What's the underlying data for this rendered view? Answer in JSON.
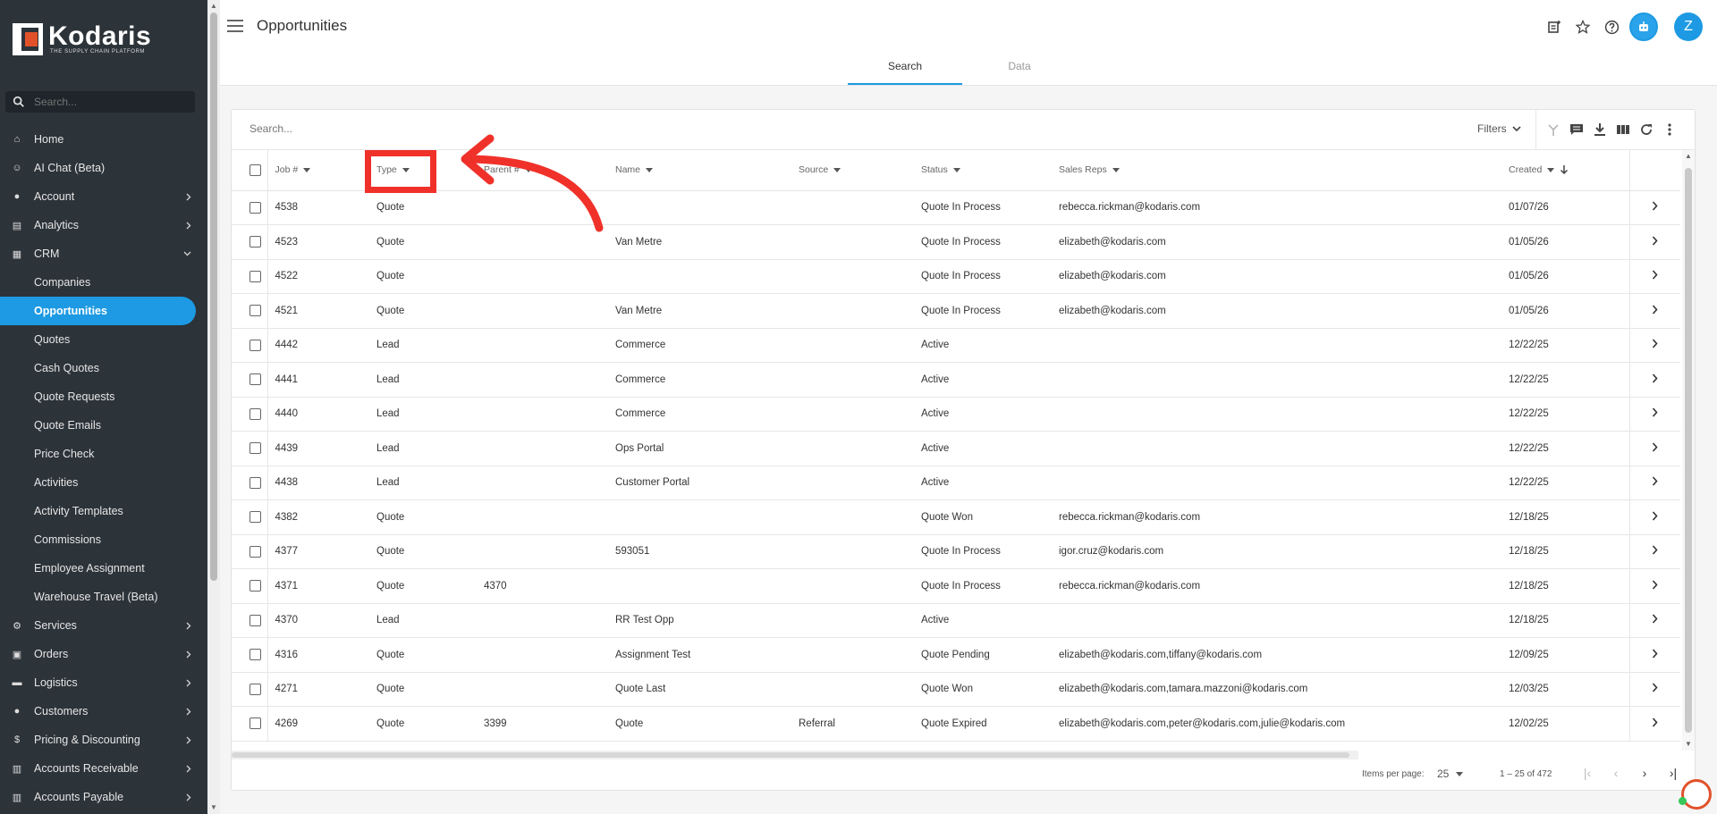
{
  "brand": {
    "name": "Kodaris",
    "tagline": "THE SUPPLY CHAIN PLATFORM",
    "accent": "#1d9ae3",
    "logo_orange": "#e1522b"
  },
  "sidebar": {
    "search_placeholder": "Search...",
    "items": [
      {
        "label": "Home",
        "icon": "home-icon"
      },
      {
        "label": "AI Chat (Beta)",
        "icon": "robot-icon"
      },
      {
        "label": "Account",
        "icon": "person-icon",
        "expandable": true
      },
      {
        "label": "Analytics",
        "icon": "chart-icon",
        "expandable": true
      },
      {
        "label": "CRM",
        "icon": "crm-icon",
        "expanded": true
      }
    ],
    "crm_sub": [
      "Companies",
      "Opportunities",
      "Quotes",
      "Cash Quotes",
      "Quote Requests",
      "Quote Emails",
      "Price Check",
      "Activities",
      "Activity Templates",
      "Commissions",
      "Employee Assignment",
      "Warehouse Travel (Beta)"
    ],
    "active_sub": "Opportunities",
    "items_after": [
      {
        "label": "Services",
        "icon": "services-icon"
      },
      {
        "label": "Orders",
        "icon": "orders-icon"
      },
      {
        "label": "Logistics",
        "icon": "truck-icon"
      },
      {
        "label": "Customers",
        "icon": "people-icon"
      },
      {
        "label": "Pricing & Discounting",
        "icon": "dollar-icon"
      },
      {
        "label": "Accounts Receivable",
        "icon": "bank-icon"
      },
      {
        "label": "Accounts Payable",
        "icon": "bank-icon"
      }
    ]
  },
  "header": {
    "title": "Opportunities",
    "avatar_initial": "Z"
  },
  "tabs": [
    {
      "label": "Search",
      "active": true
    },
    {
      "label": "Data",
      "active": false
    }
  ],
  "toolbar": {
    "search_placeholder": "Search...",
    "filters_label": "Filters"
  },
  "table": {
    "columns": [
      "Job #",
      "Type",
      "Parent #",
      "Name",
      "Source",
      "Status",
      "Sales Reps",
      "Created"
    ],
    "rows": [
      [
        "4538",
        "Quote",
        "",
        "",
        "",
        "Quote In Process",
        "rebecca.rickman@kodaris.com",
        "01/07/26"
      ],
      [
        "4523",
        "Quote",
        "",
        "Van Metre",
        "",
        "Quote In Process",
        "elizabeth@kodaris.com",
        "01/05/26"
      ],
      [
        "4522",
        "Quote",
        "",
        "",
        "",
        "Quote In Process",
        "elizabeth@kodaris.com",
        "01/05/26"
      ],
      [
        "4521",
        "Quote",
        "",
        "Van Metre",
        "",
        "Quote In Process",
        "elizabeth@kodaris.com",
        "01/05/26"
      ],
      [
        "4442",
        "Lead",
        "",
        "Commerce",
        "",
        "Active",
        "",
        "12/22/25"
      ],
      [
        "4441",
        "Lead",
        "",
        "Commerce",
        "",
        "Active",
        "",
        "12/22/25"
      ],
      [
        "4440",
        "Lead",
        "",
        "Commerce",
        "",
        "Active",
        "",
        "12/22/25"
      ],
      [
        "4439",
        "Lead",
        "",
        "Ops Portal",
        "",
        "Active",
        "",
        "12/22/25"
      ],
      [
        "4438",
        "Lead",
        "",
        "Customer Portal",
        "",
        "Active",
        "",
        "12/22/25"
      ],
      [
        "4382",
        "Quote",
        "",
        "",
        "",
        "Quote Won",
        "rebecca.rickman@kodaris.com",
        "12/18/25"
      ],
      [
        "4377",
        "Quote",
        "",
        "593051",
        "",
        "Quote In Process",
        "igor.cruz@kodaris.com",
        "12/18/25"
      ],
      [
        "4371",
        "Quote",
        "4370",
        "",
        "",
        "Quote In Process",
        "rebecca.rickman@kodaris.com",
        "12/18/25"
      ],
      [
        "4370",
        "Lead",
        "",
        "RR Test Opp",
        "",
        "Active",
        "",
        "12/18/25"
      ],
      [
        "4316",
        "Quote",
        "",
        "Assignment Test",
        "",
        "Quote Pending",
        "elizabeth@kodaris.com,tiffany@kodaris.com",
        "12/09/25"
      ],
      [
        "4271",
        "Quote",
        "",
        "Quote Last",
        "",
        "Quote Won",
        "elizabeth@kodaris.com,tamara.mazzoni@kodaris.com",
        "12/03/25"
      ],
      [
        "4269",
        "Quote",
        "3399",
        "Quote",
        "Referral",
        "Quote Expired",
        "elizabeth@kodaris.com,peter@kodaris.com,julie@kodaris.com",
        "12/02/25"
      ]
    ]
  },
  "pager": {
    "items_per_page_label": "Items per page:",
    "items_per_page": "25",
    "range": "1 – 25 of 472"
  },
  "annotation_color": "#f0312a"
}
